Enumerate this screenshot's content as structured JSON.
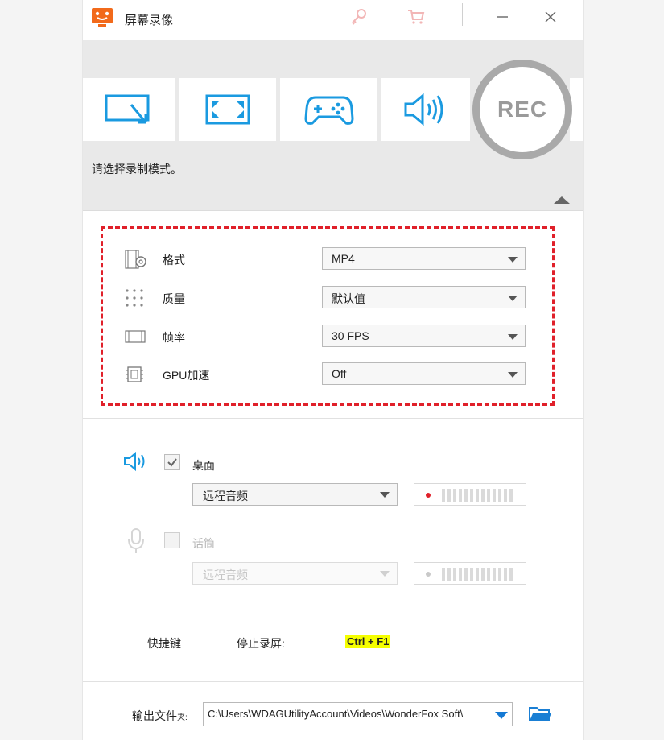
{
  "titlebar": {
    "title": "屏幕录像",
    "icons": [
      "app-logo-icon",
      "key-icon",
      "cart-icon",
      "minimize-icon",
      "close-icon"
    ]
  },
  "modes": {
    "buttons": [
      "region-icon",
      "fullscreen-icon",
      "gamepad-icon",
      "speaker-icon"
    ],
    "rec_label": "REC",
    "hint": "请选择录制模式。"
  },
  "settings": {
    "format": {
      "label": "格式",
      "value": "MP4"
    },
    "quality": {
      "label": "质量",
      "value": "默认值"
    },
    "framerate": {
      "label": "帧率",
      "value": "30 FPS"
    },
    "gpu": {
      "label": "GPU加速",
      "value": "Off"
    }
  },
  "audio": {
    "desktop": {
      "label": "桌面",
      "checked": true,
      "source": "远程音频"
    },
    "mic": {
      "label": "话筒",
      "checked": false,
      "source": "远程音频"
    }
  },
  "hotkeys": {
    "title": "快捷键",
    "stop_label": "停止录屏:",
    "stop_value": "Ctrl + F1"
  },
  "output": {
    "label": "输出文件",
    "label_suffix": "夹:",
    "path": "C:\\Users\\WDAGUtilityAccount\\Videos\\WonderFox Soft\\"
  },
  "colors": {
    "accent_blue": "#1a9ae0",
    "dashed_red": "#e0202a",
    "highlight_yellow": "#f5ff00",
    "logo_orange": "#f26a1b"
  }
}
